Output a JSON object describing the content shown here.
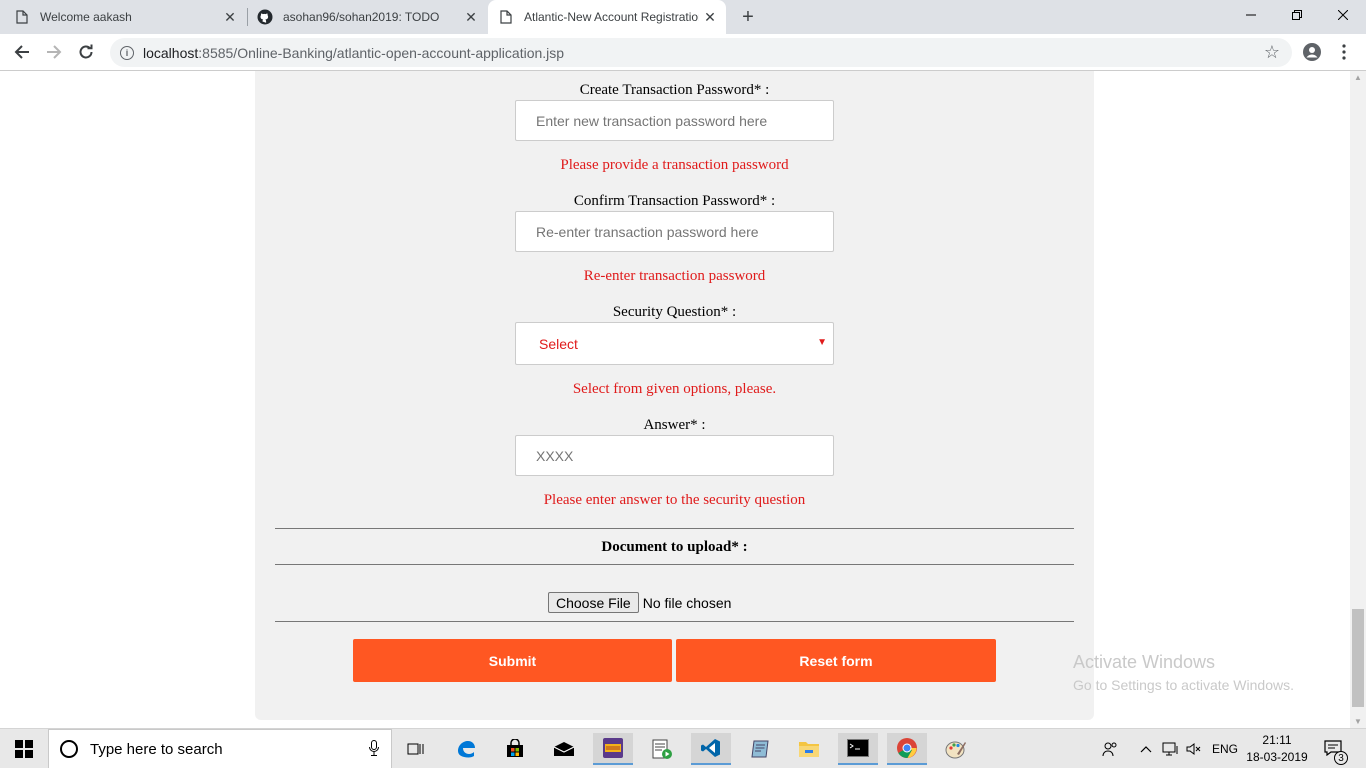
{
  "browser": {
    "tabs": [
      {
        "title": "Welcome aakash",
        "icon": "page-icon"
      },
      {
        "title": "asohan96/sohan2019: TODO",
        "icon": "github-icon"
      },
      {
        "title": "Atlantic-New Account Registration",
        "icon": "page-icon"
      }
    ],
    "active_tab": 2,
    "url_host": "localhost",
    "url_rest": ":8585/Online-Banking/atlantic-open-account-application.jsp"
  },
  "form": {
    "txn_password": {
      "label": "Create Transaction Password* :",
      "placeholder": "Enter new transaction password here",
      "error": "Please provide a transaction password"
    },
    "confirm_txn_password": {
      "label": "Confirm Transaction Password* :",
      "placeholder": "Re-enter transaction password here",
      "error": "Re-enter transaction password"
    },
    "security_question": {
      "label": "Security Question* :",
      "value": "Select",
      "error": "Select from given options, please."
    },
    "answer": {
      "label": "Answer* :",
      "placeholder": "XXXX",
      "error": "Please enter answer to the security question"
    },
    "document": {
      "label": "Document to upload* :",
      "choose_label": "Choose File",
      "status": "No file chosen"
    },
    "submit_label": "Submit",
    "reset_label": "Reset form",
    "accent_color": "#ff5722",
    "error_color": "#e01b1b"
  },
  "watermark": {
    "line1": "Activate Windows",
    "line2": "Go to Settings to activate Windows."
  },
  "taskbar": {
    "search_text": "Type here to search",
    "language": "ENG",
    "time": "21:11",
    "date": "18-03-2019",
    "notifications": "3"
  }
}
